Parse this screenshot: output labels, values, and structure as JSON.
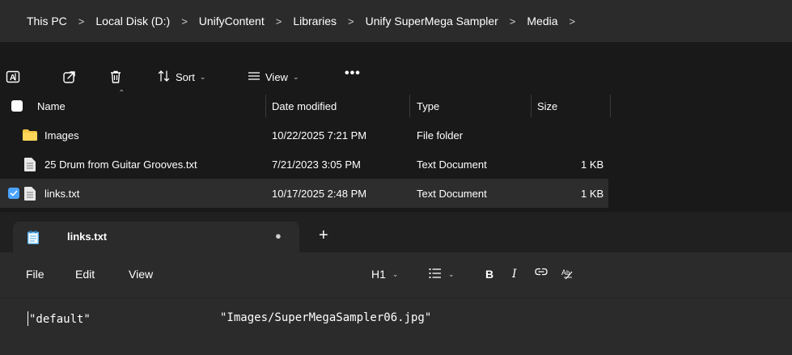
{
  "explorer": {
    "breadcrumb": [
      "This PC",
      "Local Disk (D:)",
      "UnifyContent",
      "Libraries",
      "Unify SuperMega Sampler",
      "Media"
    ],
    "toolbar": {
      "sort_label": "Sort",
      "view_label": "View",
      "more_label": "•••"
    },
    "columns": {
      "name": "Name",
      "date": "Date modified",
      "type": "Type",
      "size": "Size"
    },
    "rows": [
      {
        "name": "Images",
        "date": "10/22/2025 7:21 PM",
        "type": "File folder",
        "size": "",
        "icon": "folder-icon",
        "selected": false
      },
      {
        "name": "25 Drum from Guitar Grooves.txt",
        "date": "7/21/2023 3:05 PM",
        "type": "Text Document",
        "size": "1 KB",
        "icon": "text-file-icon",
        "selected": false
      },
      {
        "name": "links.txt",
        "date": "10/17/2025 2:48 PM",
        "type": "Text Document",
        "size": "1 KB",
        "icon": "text-file-icon",
        "selected": true
      }
    ]
  },
  "notepad": {
    "tab_title": "links.txt",
    "tab_unsaved_dot": "●",
    "new_tab": "+",
    "menu": [
      "File",
      "Edit",
      "View"
    ],
    "format": {
      "heading": "H1",
      "bold": "B",
      "italic": "I"
    },
    "content": {
      "key": "\"default\"",
      "value": "\"Images/SuperMegaSampler06.jpg\""
    }
  },
  "colors": {
    "accent": "#4aa3ff",
    "folder": "#f4c542",
    "background": "#191919"
  }
}
